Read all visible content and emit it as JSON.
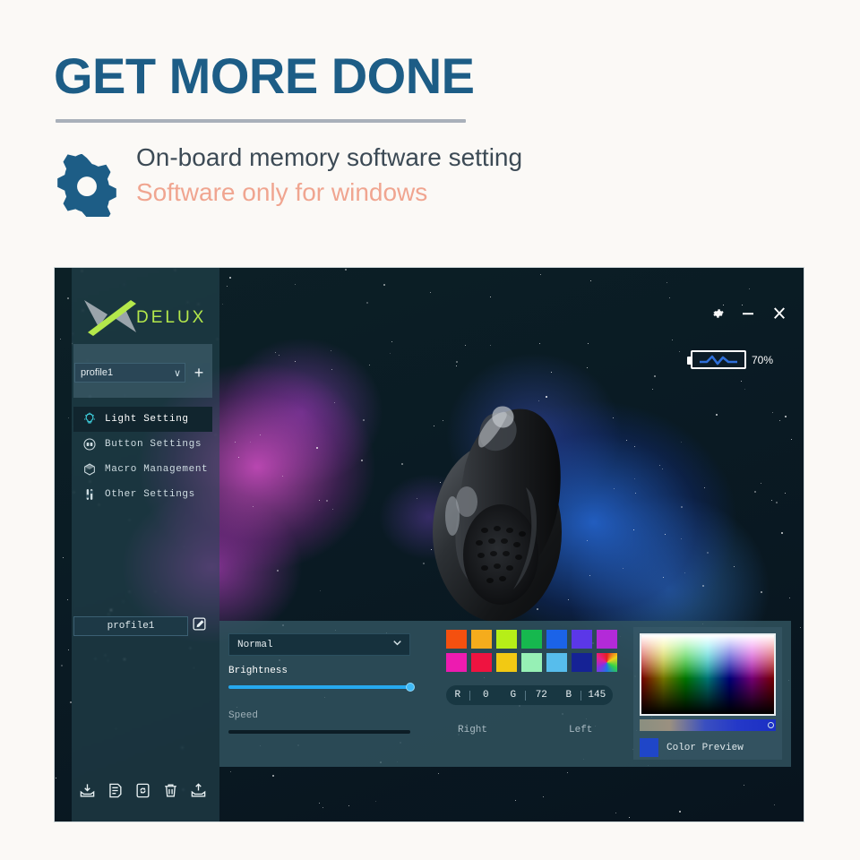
{
  "promo": {
    "headline": "GET MORE DONE",
    "subtitle_primary": "On-board memory software setting",
    "subtitle_secondary": "Software only for windows",
    "gear_icon": "gear-icon",
    "headline_color": "#1d5d86",
    "secondary_color": "#f0a590",
    "divider_color": "#a9b0ba",
    "page_background": "#fbf9f6"
  },
  "app": {
    "brand": "DELUX",
    "brand_color": "#b4e84b",
    "window_background": "#0e2429",
    "titlebar": {
      "settings_icon": "gear-icon",
      "minimize_icon": "minimize-icon",
      "minimize_label": "–",
      "close_icon": "close-icon",
      "close_label": "X"
    },
    "battery": {
      "icon": "battery-charging-icon",
      "percent_label": "70%",
      "level": 70
    },
    "sidebar": {
      "profile_select": {
        "value": "profile1",
        "chevron_icon": "chevron-down-icon",
        "chevron_label": "∨",
        "add_icon": "plus-icon",
        "add_label": "+"
      },
      "nav_items": [
        {
          "label": "Light Setting",
          "icon": "lightbulb-icon",
          "active": true
        },
        {
          "label": "Button Settings",
          "icon": "mouse-buttons-icon",
          "active": false
        },
        {
          "label": "Macro Management",
          "icon": "cube-icon",
          "active": false
        },
        {
          "label": "Other Settings",
          "icon": "sliders-icon",
          "active": false
        }
      ],
      "profile_name": {
        "value": "profile1",
        "edit_icon": "edit-pencil-icon"
      },
      "tools": [
        {
          "icon": "import-icon",
          "label": "Import"
        },
        {
          "icon": "document-icon",
          "label": "Document"
        },
        {
          "icon": "refresh-icon",
          "label": "Refresh"
        },
        {
          "icon": "trash-icon",
          "label": "Delete"
        },
        {
          "icon": "export-icon",
          "label": "Export"
        }
      ]
    },
    "light_panel": {
      "mode_select": {
        "value": "Normal",
        "chevron_icon": "chevron-down-icon",
        "chevron_label": "∨"
      },
      "brightness": {
        "label": "Brightness",
        "value": 100,
        "fill_color": "#26a9ef"
      },
      "speed": {
        "label": "Speed",
        "value": 0,
        "disabled": true
      },
      "swatch_rows": [
        [
          "#f4500f",
          "#f5ac1c",
          "#b6ee18",
          "#16b84e",
          "#1b63e8",
          "#5b37e8",
          "#b32ad8"
        ],
        [
          "#ed1bb0",
          "#ef1340",
          "#f2c913",
          "#96f0b5",
          "#57bdec",
          "#152295",
          "rainbow"
        ]
      ],
      "rgb": {
        "r_label": "R",
        "r_value": "0",
        "g_label": "G",
        "g_value": "72",
        "b_label": "B",
        "b_value": "145"
      },
      "zone_labels": {
        "right": "Right",
        "left": "Left"
      },
      "color_picker": {
        "preview_label": "Color Preview",
        "preview_color": "#1f46c8"
      }
    },
    "product_image_name": "vertical-ergonomic-mouse"
  }
}
